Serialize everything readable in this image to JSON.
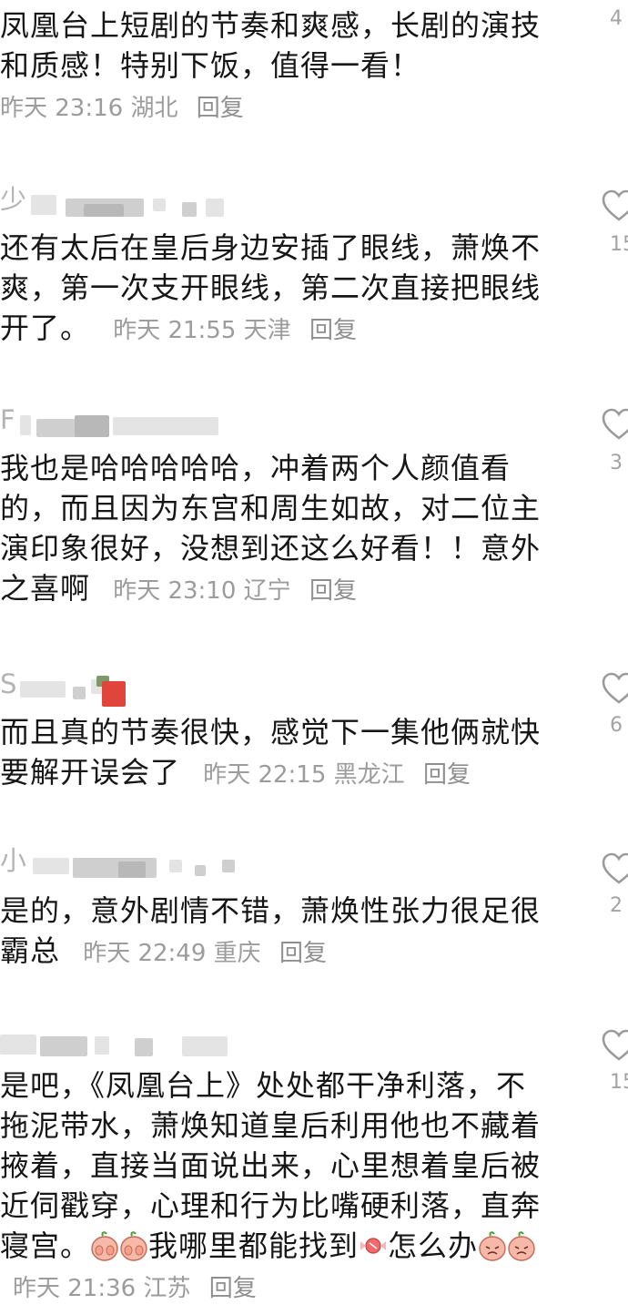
{
  "comments": [
    {
      "username": "",
      "text": "凤凰台上短剧的节奏和爽感，长剧的演技和质感！特别下饭，值得一看！",
      "time": "昨天 23:16",
      "location": "湖北",
      "reply": "回复",
      "likes": "4"
    },
    {
      "username": "少",
      "text": "还有太后在皇后身边安插了眼线，萧焕不爽，第一次支开眼线，第二次直接把眼线开了。",
      "time": "昨天 21:55",
      "location": "天津",
      "reply": "回复",
      "likes": "15"
    },
    {
      "username": "F",
      "text": "我也是哈哈哈哈哈，冲着两个人颜值看的，而且因为东宫和周生如故，对二位主演印象很好，没想到还这么好看！！意外之喜啊",
      "time": "昨天 23:10",
      "location": "辽宁",
      "reply": "回复",
      "likes": "3"
    },
    {
      "username": "S",
      "text": "而且真的节奏很快，感觉下一集他俩就快要解开误会了",
      "time": "昨天 22:15",
      "location": "黑龙江",
      "reply": "回复",
      "likes": "6"
    },
    {
      "username": "小",
      "text": "是的，意外剧情不错，萧焕性张力很足很霸总",
      "time": "昨天 22:49",
      "location": "重庆",
      "reply": "回复",
      "likes": "2"
    },
    {
      "username": "",
      "text_a": "是吧，《凤凰台上》处处都干净利落，不拖泥带水，萧焕知道皇后利用他也不藏着掖着，直接当面说出来，心里想着皇后被近伺戳穿，心理和行为比嘴硬利落，直奔寝宫。",
      "text_b": "我哪里都能找到",
      "text_c": "怎么办",
      "time": "昨天 21:36",
      "location": "江苏",
      "reply": "回复",
      "likes": "15"
    }
  ],
  "icons": {
    "like": "heart-outline-icon",
    "emoji_cover": "peach-covering-face-emoji",
    "emoji_candy": "candy-emoji",
    "emoji_cry": "peach-crying-emoji"
  },
  "colors": {
    "text": "#161616",
    "meta": "#9c9c9c",
    "icon": "#9a9a9a"
  }
}
